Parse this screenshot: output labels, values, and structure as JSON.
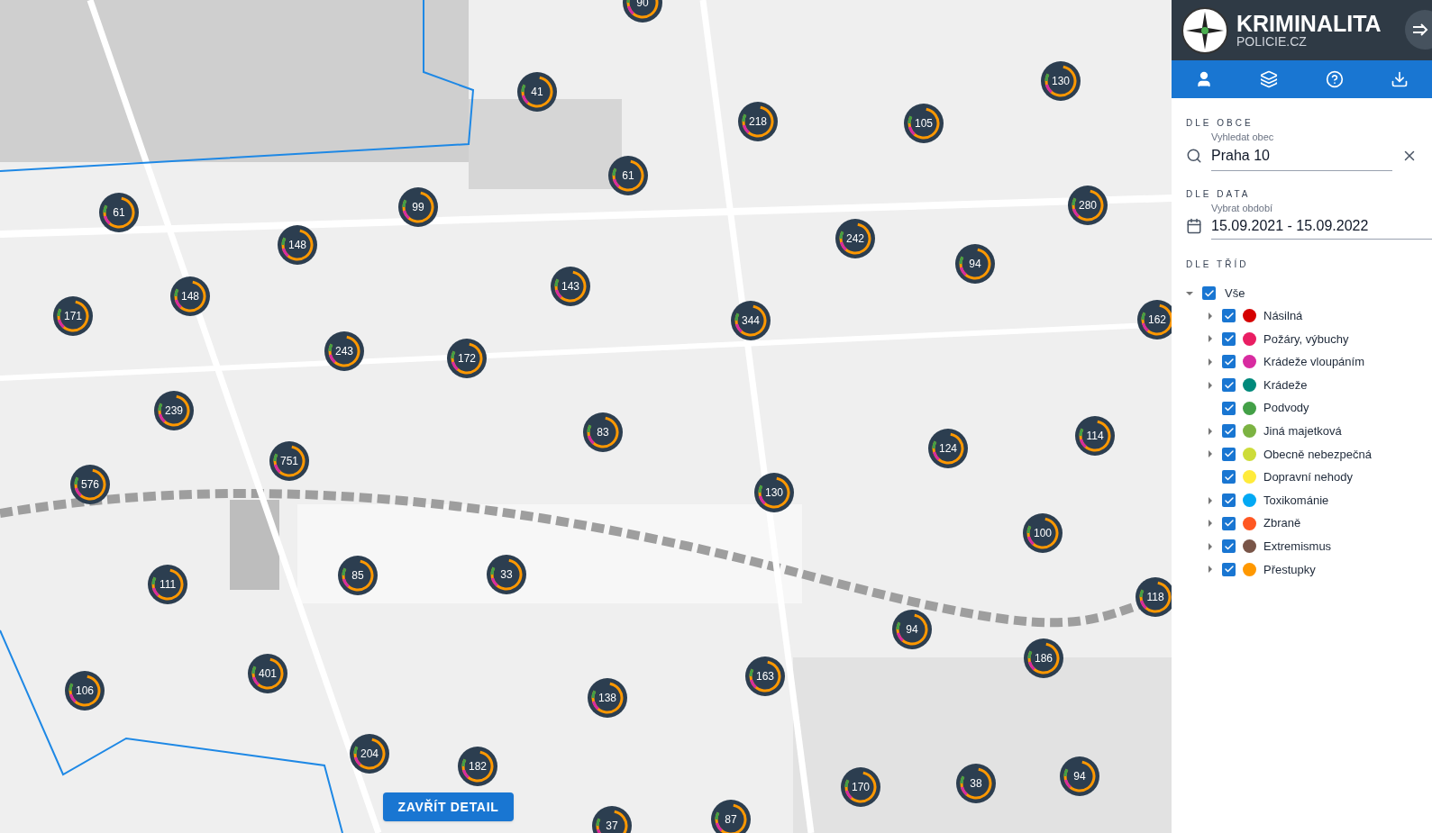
{
  "map": {
    "kind": "picture",
    "clusters": [
      {
        "count": "90"
      },
      {
        "count": "41"
      },
      {
        "count": "218"
      },
      {
        "count": "105"
      },
      {
        "count": "130"
      },
      {
        "count": "61"
      },
      {
        "count": "61"
      },
      {
        "count": "99"
      },
      {
        "count": "280"
      },
      {
        "count": "242"
      },
      {
        "count": "148"
      },
      {
        "count": "94"
      },
      {
        "count": "148"
      },
      {
        "count": "171"
      },
      {
        "count": "143"
      },
      {
        "count": "344"
      },
      {
        "count": "162"
      },
      {
        "count": "243"
      },
      {
        "count": "172"
      },
      {
        "count": "239"
      },
      {
        "count": "83"
      },
      {
        "count": "751"
      },
      {
        "count": "124"
      },
      {
        "count": "114"
      },
      {
        "count": "576"
      },
      {
        "count": "130"
      },
      {
        "count": "100"
      },
      {
        "count": "33"
      },
      {
        "count": "85"
      },
      {
        "count": "111"
      },
      {
        "count": "118"
      },
      {
        "count": "94"
      },
      {
        "count": "186"
      },
      {
        "count": "401"
      },
      {
        "count": "163"
      },
      {
        "count": "138"
      },
      {
        "count": "106"
      },
      {
        "count": "204"
      },
      {
        "count": "182"
      },
      {
        "count": "170"
      },
      {
        "count": "38"
      },
      {
        "count": "94"
      },
      {
        "count": "37"
      },
      {
        "count": "87"
      }
    ],
    "close_button": "ZAVŘÍT DETAIL"
  },
  "sidebar": {
    "logo_title": "KRIMINALITA",
    "logo_subtitle": "POLICIE.CZ",
    "municipality": {
      "heading": "DLE OBCE",
      "label": "Vyhledat obec",
      "value": "Praha 10"
    },
    "date": {
      "heading": "DLE DATA",
      "label": "Vybrat období",
      "value": "15.09.2021 - 15.09.2022"
    },
    "classes": {
      "heading": "DLE TŘÍD",
      "root": {
        "label": "Vše",
        "checked": true,
        "expanded": true
      },
      "items": [
        {
          "label": "Násilná",
          "color": "#d50000",
          "checked": true,
          "expandable": true
        },
        {
          "label": "Požáry, výbuchy",
          "color": "#e91e63",
          "checked": true,
          "expandable": true
        },
        {
          "label": "Krádeže vloupáním",
          "color": "#d82ba0",
          "checked": true,
          "expandable": true
        },
        {
          "label": "Krádeže",
          "color": "#00897b",
          "checked": true,
          "expandable": true
        },
        {
          "label": "Podvody",
          "color": "#43a047",
          "checked": true,
          "expandable": false
        },
        {
          "label": "Jiná majetková",
          "color": "#7cb342",
          "checked": true,
          "expandable": true
        },
        {
          "label": "Obecně nebezpečná",
          "color": "#cddc39",
          "checked": true,
          "expandable": true
        },
        {
          "label": "Dopravní nehody",
          "color": "#ffeb3b",
          "checked": true,
          "expandable": false
        },
        {
          "label": "Toxikománie",
          "color": "#03a9f4",
          "checked": true,
          "expandable": true
        },
        {
          "label": "Zbraně",
          "color": "#ff5722",
          "checked": true,
          "expandable": true
        },
        {
          "label": "Extremismus",
          "color": "#795548",
          "checked": true,
          "expandable": true
        },
        {
          "label": "Přestupky",
          "color": "#ff9800",
          "checked": true,
          "expandable": true
        }
      ]
    }
  }
}
